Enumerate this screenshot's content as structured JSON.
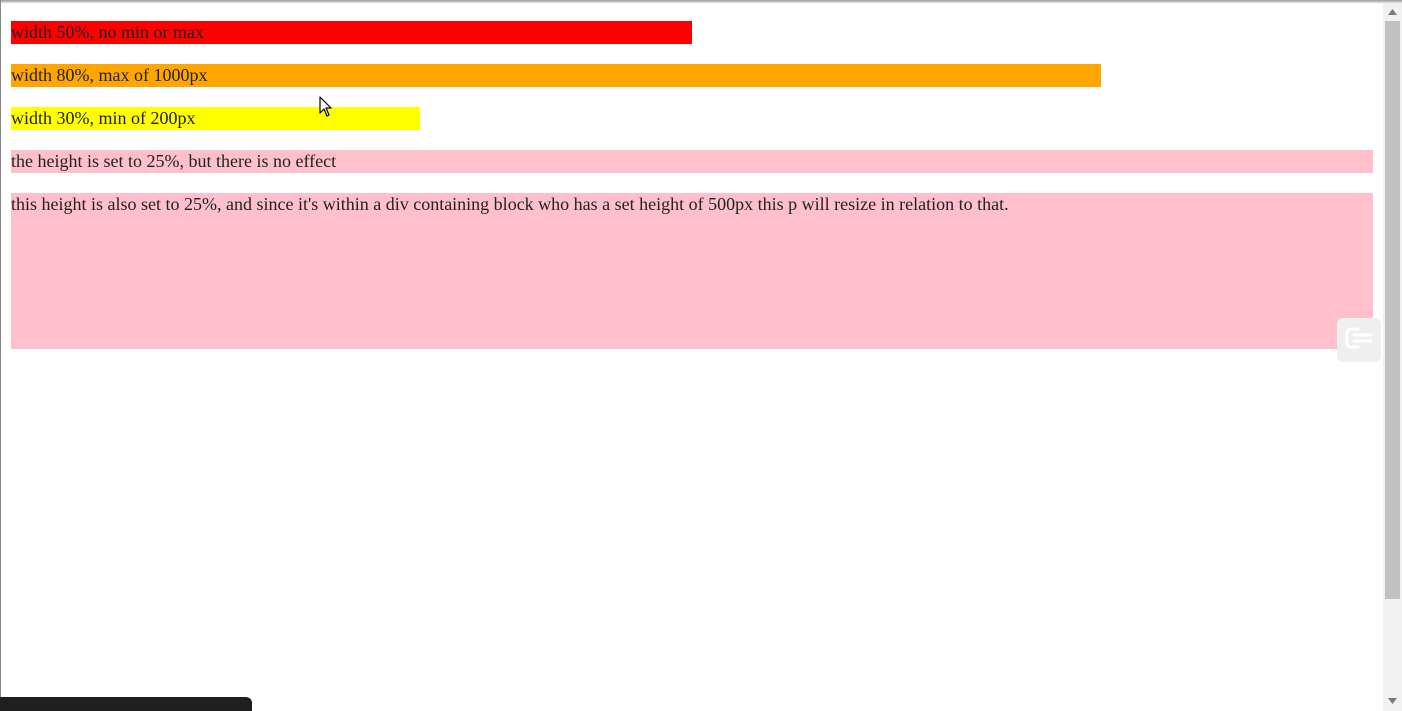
{
  "blocks": [
    {
      "text": "width 50%, no min or max",
      "color": "#ff0000"
    },
    {
      "text": "width 80%, max of 1000px",
      "color": "#ffa500"
    },
    {
      "text": "width 30%, min of 200px",
      "color": "#ffff00"
    },
    {
      "text": "the height is set to 25%, but there is no effect",
      "color": "#ffc0cb"
    },
    {
      "text": "this height is also set to 25%, and since it's within a div containing block who has a set height of 500px this p will resize in relation to that.",
      "color": "#ffc0cb"
    }
  ],
  "icons": {
    "scroll_up": "chevron-up-icon",
    "scroll_down": "chevron-down-icon",
    "floating_button": "extension-logo-icon",
    "cursor": "mouse-pointer-icon"
  }
}
